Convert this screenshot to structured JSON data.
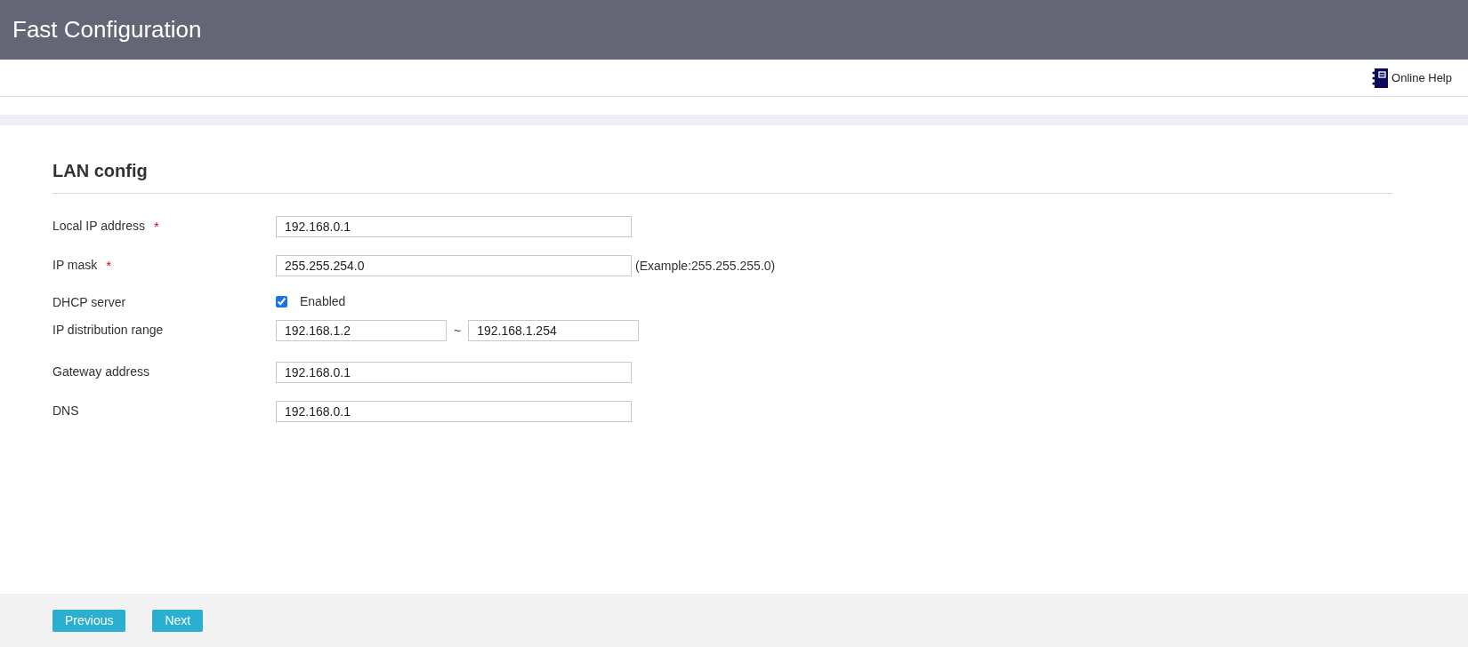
{
  "header": {
    "title": "Fast Configuration"
  },
  "toolbar": {
    "help_link": "Online Help"
  },
  "section": {
    "title": "LAN config"
  },
  "fields": [
    {
      "kind": "text",
      "label": "Local IP address",
      "required": true,
      "value": "192.168.0.1"
    },
    {
      "kind": "text",
      "label": "IP mask",
      "required": true,
      "value": "255.255.254.0",
      "hint": "(Example:255.255.255.0)"
    },
    {
      "kind": "checkbox",
      "label": "DHCP server",
      "checked": true,
      "option": "Enabled"
    },
    {
      "kind": "range",
      "label": "IP distribution range",
      "from": "192.168.1.2",
      "separator": "~",
      "to": "192.168.1.254"
    },
    {
      "kind": "text",
      "label": "Gateway address",
      "required": false,
      "value": "192.168.0.1"
    },
    {
      "kind": "text",
      "label": "DNS",
      "required": false,
      "value": "192.168.0.1"
    }
  ],
  "required_mark": "*",
  "buttons": [
    "Previous",
    "Next"
  ]
}
